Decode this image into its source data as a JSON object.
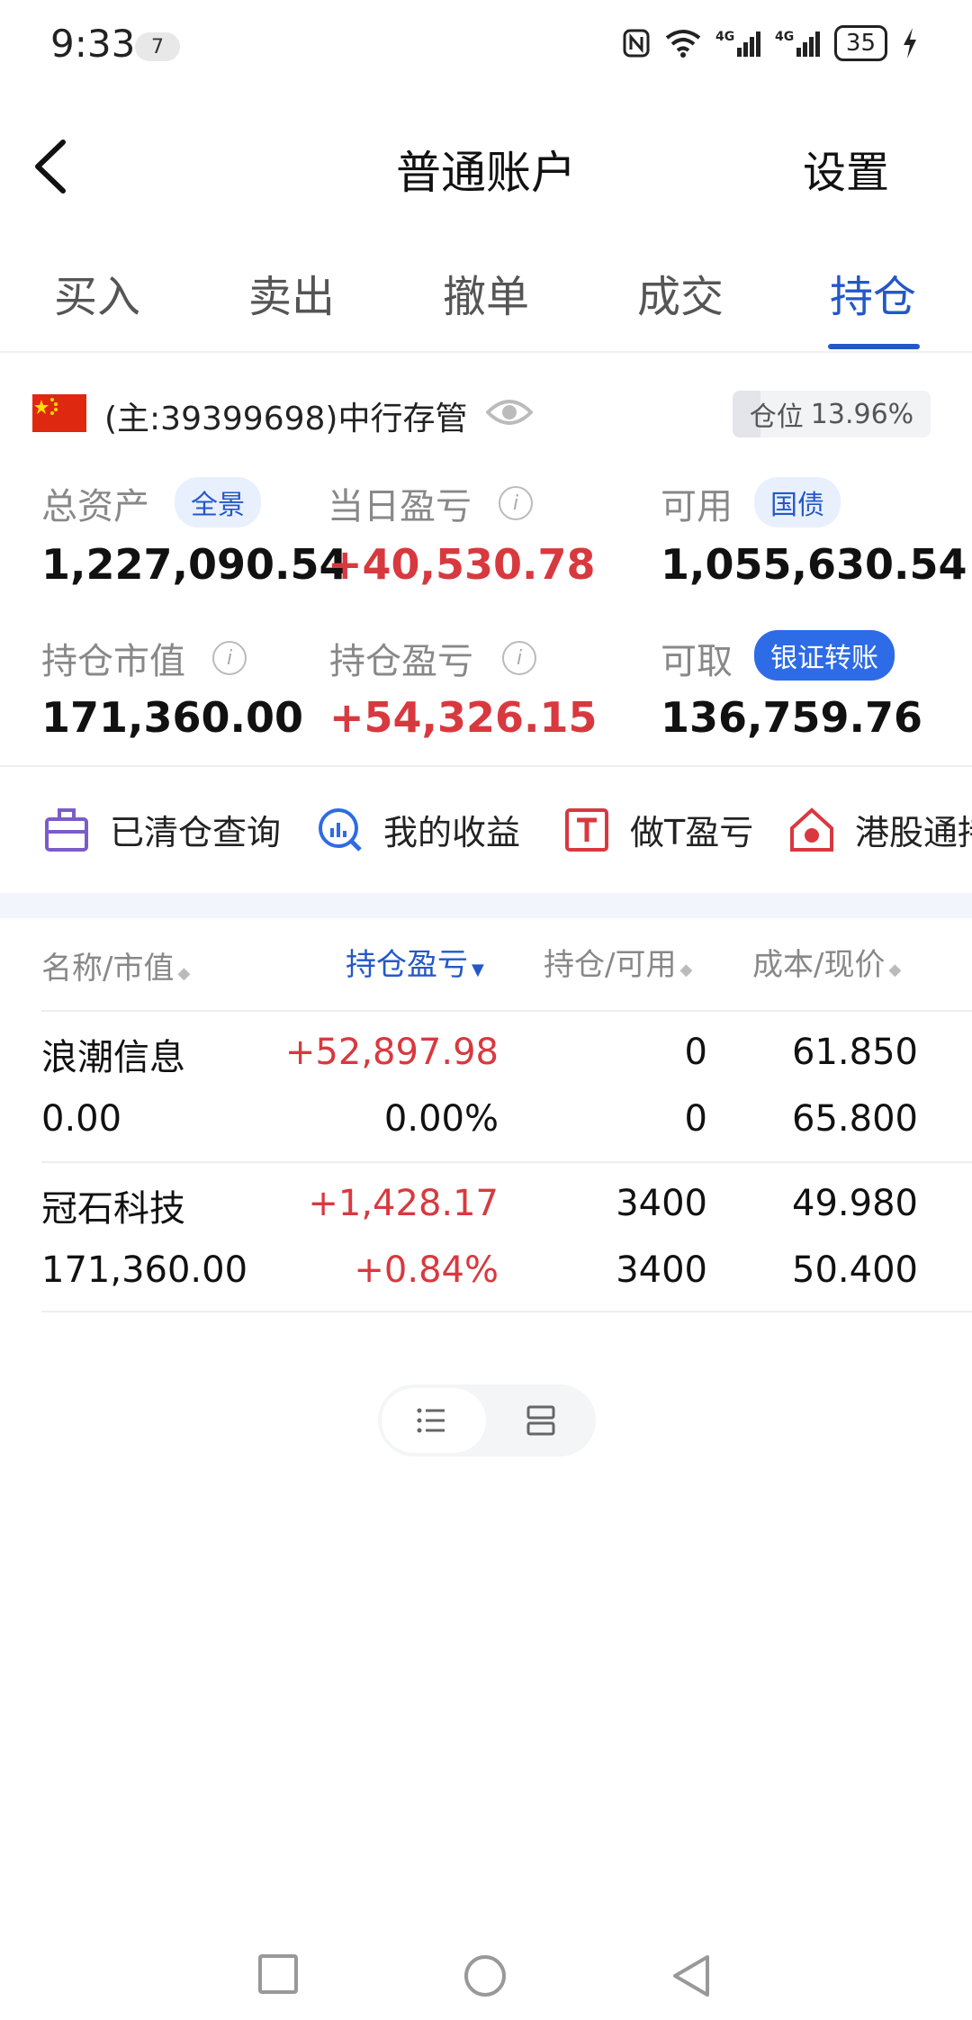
{
  "status_bar": {
    "time": "9:33",
    "notification_count": "7",
    "icons": [
      "nfc-icon",
      "wifi-icon",
      "4g-signal-icon",
      "4g-signal-icon"
    ],
    "battery": "35"
  },
  "header": {
    "title": "普通账户",
    "settings_label": "设置"
  },
  "tabs": [
    {
      "label": "买入",
      "active": false
    },
    {
      "label": "卖出",
      "active": false
    },
    {
      "label": "撤单",
      "active": false
    },
    {
      "label": "成交",
      "active": false
    },
    {
      "label": "持仓",
      "active": true
    }
  ],
  "account": {
    "label": "(主:39399698)中行存管",
    "position_ratio_label": "仓位",
    "position_ratio_value": "13.96%",
    "position_ratio_fraction": 0.1396
  },
  "stats": {
    "total_assets_label": "总资产",
    "total_assets_pill": "全景",
    "total_assets_value": "1,227,090.54",
    "daily_pnl_label": "当日盈亏",
    "daily_pnl_value": "+40,530.78",
    "available_label": "可用",
    "available_pill": "国债",
    "available_value": "1,055,630.54",
    "market_value_label": "持仓市值",
    "market_value_value": "171,360.00",
    "position_pnl_label": "持仓盈亏",
    "position_pnl_value": "+54,326.15",
    "withdrawable_label": "可取",
    "withdrawable_pill": "银证转账",
    "withdrawable_value": "136,759.76"
  },
  "quick_links": [
    {
      "label": "已清仓查询",
      "icon": "briefcase-icon"
    },
    {
      "label": "我的收益",
      "icon": "chart-search-icon"
    },
    {
      "label": "做T盈亏",
      "icon": "t-box-icon"
    },
    {
      "label": "港股通持",
      "icon": "hk-flag-house-icon"
    }
  ],
  "table": {
    "headers": {
      "name": "名称/市值",
      "pnl": "持仓盈亏",
      "holding": "持仓/可用",
      "cost": "成本/现价"
    },
    "rows": [
      {
        "name": "浪潮信息",
        "market_value": "0.00",
        "pnl": "+52,897.98",
        "pnl_pct": "0.00%",
        "holding": "0",
        "available": "0",
        "cost": "61.850",
        "price": "65.800"
      },
      {
        "name": "冠石科技",
        "market_value": "171,360.00",
        "pnl": "+1,428.17",
        "pnl_pct": "+0.84%",
        "holding": "3400",
        "available": "3400",
        "cost": "49.980",
        "price": "50.400"
      }
    ]
  },
  "colors": {
    "accent": "#2458c8",
    "profit": "#d8393f"
  }
}
